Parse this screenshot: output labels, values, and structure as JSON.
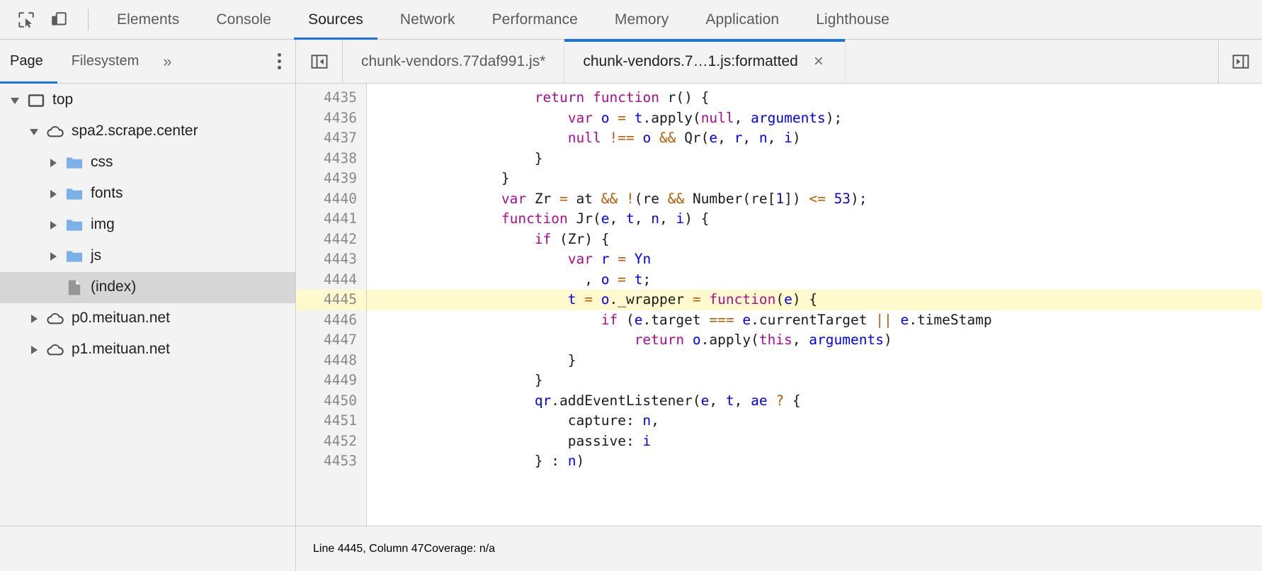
{
  "toolbar": {
    "inspect_icon": "inspect-element-icon",
    "device_icon": "device-toolbar-icon",
    "tabs": [
      {
        "label": "Elements",
        "active": false
      },
      {
        "label": "Console",
        "active": false
      },
      {
        "label": "Sources",
        "active": true
      },
      {
        "label": "Network",
        "active": false
      },
      {
        "label": "Performance",
        "active": false
      },
      {
        "label": "Memory",
        "active": false
      },
      {
        "label": "Application",
        "active": false
      },
      {
        "label": "Lighthouse",
        "active": false
      }
    ]
  },
  "navigator": {
    "tabs": [
      {
        "label": "Page",
        "active": true
      },
      {
        "label": "Filesystem",
        "active": false
      }
    ],
    "more_label": "»",
    "kebab_icon": "more-options-icon",
    "tree": [
      {
        "label": "top",
        "indent": 0,
        "twisty": "open",
        "icon": "frame-icon",
        "selected": false
      },
      {
        "label": "spa2.scrape.center",
        "indent": 1,
        "twisty": "open",
        "icon": "cloud-icon",
        "selected": false
      },
      {
        "label": "css",
        "indent": 2,
        "twisty": "closed",
        "icon": "folder-icon",
        "selected": false
      },
      {
        "label": "fonts",
        "indent": 2,
        "twisty": "closed",
        "icon": "folder-icon",
        "selected": false
      },
      {
        "label": "img",
        "indent": 2,
        "twisty": "closed",
        "icon": "folder-icon",
        "selected": false
      },
      {
        "label": "js",
        "indent": 2,
        "twisty": "closed",
        "icon": "folder-icon",
        "selected": false
      },
      {
        "label": "(index)",
        "indent": 2,
        "twisty": "none",
        "icon": "document-icon",
        "selected": true
      },
      {
        "label": "p0.meituan.net",
        "indent": 1,
        "twisty": "closed",
        "icon": "cloud-icon",
        "selected": false
      },
      {
        "label": "p1.meituan.net",
        "indent": 1,
        "twisty": "closed",
        "icon": "cloud-icon",
        "selected": false
      }
    ]
  },
  "editor": {
    "sidebar_toggle_icon": "show-navigator-icon",
    "expand_icon": "more-tabs-icon",
    "tabs": [
      {
        "label": "chunk-vendors.77daf991.js*",
        "active": false,
        "closable": false
      },
      {
        "label": "chunk-vendors.7…1.js:formatted",
        "active": true,
        "closable": true
      }
    ],
    "close_label": "×",
    "first_line_number": 4435,
    "highlighted_line": 4445,
    "lines": [
      {
        "n": 4435,
        "tokens": [
          {
            "t": "                    ",
            "c": "pl"
          },
          {
            "t": "return",
            "c": "kw"
          },
          {
            "t": " ",
            "c": "pl"
          },
          {
            "t": "function",
            "c": "kw"
          },
          {
            "t": " r() {",
            "c": "pl"
          }
        ]
      },
      {
        "n": 4436,
        "tokens": [
          {
            "t": "                        ",
            "c": "pl"
          },
          {
            "t": "var",
            "c": "kw"
          },
          {
            "t": " ",
            "c": "pl"
          },
          {
            "t": "o",
            "c": "var"
          },
          {
            "t": " ",
            "c": "pl"
          },
          {
            "t": "=",
            "c": "op"
          },
          {
            "t": " ",
            "c": "pl"
          },
          {
            "t": "t",
            "c": "var"
          },
          {
            "t": ".apply(",
            "c": "pl"
          },
          {
            "t": "null",
            "c": "kw"
          },
          {
            "t": ", ",
            "c": "pl"
          },
          {
            "t": "arguments",
            "c": "var"
          },
          {
            "t": ");",
            "c": "pl"
          }
        ]
      },
      {
        "n": 4437,
        "tokens": [
          {
            "t": "                        ",
            "c": "pl"
          },
          {
            "t": "null",
            "c": "kw"
          },
          {
            "t": " ",
            "c": "pl"
          },
          {
            "t": "!==",
            "c": "op"
          },
          {
            "t": " ",
            "c": "pl"
          },
          {
            "t": "o",
            "c": "var"
          },
          {
            "t": " ",
            "c": "pl"
          },
          {
            "t": "&&",
            "c": "op"
          },
          {
            "t": " Qr(",
            "c": "pl"
          },
          {
            "t": "e",
            "c": "var"
          },
          {
            "t": ", ",
            "c": "pl"
          },
          {
            "t": "r",
            "c": "var"
          },
          {
            "t": ", ",
            "c": "pl"
          },
          {
            "t": "n",
            "c": "var"
          },
          {
            "t": ", ",
            "c": "pl"
          },
          {
            "t": "i",
            "c": "var"
          },
          {
            "t": ")",
            "c": "pl"
          }
        ]
      },
      {
        "n": 4438,
        "tokens": [
          {
            "t": "                    }",
            "c": "pl"
          }
        ]
      },
      {
        "n": 4439,
        "tokens": [
          {
            "t": "                }",
            "c": "pl"
          }
        ]
      },
      {
        "n": 4440,
        "tokens": [
          {
            "t": "                ",
            "c": "pl"
          },
          {
            "t": "var",
            "c": "kw"
          },
          {
            "t": " Zr ",
            "c": "pl"
          },
          {
            "t": "=",
            "c": "op"
          },
          {
            "t": " at ",
            "c": "pl"
          },
          {
            "t": "&&",
            "c": "op"
          },
          {
            "t": " ",
            "c": "pl"
          },
          {
            "t": "!",
            "c": "op"
          },
          {
            "t": "(re ",
            "c": "pl"
          },
          {
            "t": "&&",
            "c": "op"
          },
          {
            "t": " Number(re[",
            "c": "pl"
          },
          {
            "t": "1",
            "c": "num"
          },
          {
            "t": "]) ",
            "c": "pl"
          },
          {
            "t": "<=",
            "c": "op"
          },
          {
            "t": " ",
            "c": "pl"
          },
          {
            "t": "53",
            "c": "num"
          },
          {
            "t": ");",
            "c": "pl"
          }
        ]
      },
      {
        "n": 4441,
        "tokens": [
          {
            "t": "                ",
            "c": "pl"
          },
          {
            "t": "function",
            "c": "kw"
          },
          {
            "t": " Jr(",
            "c": "pl"
          },
          {
            "t": "e",
            "c": "var"
          },
          {
            "t": ", ",
            "c": "pl"
          },
          {
            "t": "t",
            "c": "var"
          },
          {
            "t": ", ",
            "c": "pl"
          },
          {
            "t": "n",
            "c": "var"
          },
          {
            "t": ", ",
            "c": "pl"
          },
          {
            "t": "i",
            "c": "var"
          },
          {
            "t": ") {",
            "c": "pl"
          }
        ]
      },
      {
        "n": 4442,
        "tokens": [
          {
            "t": "                    ",
            "c": "pl"
          },
          {
            "t": "if",
            "c": "kw"
          },
          {
            "t": " (Zr) {",
            "c": "pl"
          }
        ]
      },
      {
        "n": 4443,
        "tokens": [
          {
            "t": "                        ",
            "c": "pl"
          },
          {
            "t": "var",
            "c": "kw"
          },
          {
            "t": " ",
            "c": "pl"
          },
          {
            "t": "r",
            "c": "var"
          },
          {
            "t": " ",
            "c": "pl"
          },
          {
            "t": "=",
            "c": "op"
          },
          {
            "t": " ",
            "c": "pl"
          },
          {
            "t": "Yn",
            "c": "var"
          }
        ]
      },
      {
        "n": 4444,
        "tokens": [
          {
            "t": "                          , ",
            "c": "pl"
          },
          {
            "t": "o",
            "c": "var"
          },
          {
            "t": " ",
            "c": "pl"
          },
          {
            "t": "=",
            "c": "op"
          },
          {
            "t": " ",
            "c": "pl"
          },
          {
            "t": "t",
            "c": "var"
          },
          {
            "t": ";",
            "c": "pl"
          }
        ]
      },
      {
        "n": 4445,
        "tokens": [
          {
            "t": "                        ",
            "c": "pl"
          },
          {
            "t": "t",
            "c": "var"
          },
          {
            "t": " ",
            "c": "pl"
          },
          {
            "t": "=",
            "c": "op"
          },
          {
            "t": " ",
            "c": "pl"
          },
          {
            "t": "o",
            "c": "var"
          },
          {
            "t": "._wrapper ",
            "c": "pl"
          },
          {
            "t": "=",
            "c": "op"
          },
          {
            "t": " ",
            "c": "pl"
          },
          {
            "t": "function",
            "c": "kw"
          },
          {
            "t": "(",
            "c": "pl"
          },
          {
            "t": "e",
            "c": "var"
          },
          {
            "t": ") {",
            "c": "pl"
          }
        ]
      },
      {
        "n": 4446,
        "tokens": [
          {
            "t": "                            ",
            "c": "pl"
          },
          {
            "t": "if",
            "c": "kw"
          },
          {
            "t": " (",
            "c": "pl"
          },
          {
            "t": "e",
            "c": "var"
          },
          {
            "t": ".target ",
            "c": "pl"
          },
          {
            "t": "===",
            "c": "op"
          },
          {
            "t": " ",
            "c": "pl"
          },
          {
            "t": "e",
            "c": "var"
          },
          {
            "t": ".currentTarget ",
            "c": "pl"
          },
          {
            "t": "||",
            "c": "op"
          },
          {
            "t": " ",
            "c": "pl"
          },
          {
            "t": "e",
            "c": "var"
          },
          {
            "t": ".timeStamp",
            "c": "pl"
          }
        ]
      },
      {
        "n": 4447,
        "tokens": [
          {
            "t": "                                ",
            "c": "pl"
          },
          {
            "t": "return",
            "c": "kw"
          },
          {
            "t": " ",
            "c": "pl"
          },
          {
            "t": "o",
            "c": "var"
          },
          {
            "t": ".apply(",
            "c": "pl"
          },
          {
            "t": "this",
            "c": "kw"
          },
          {
            "t": ", ",
            "c": "pl"
          },
          {
            "t": "arguments",
            "c": "var"
          },
          {
            "t": ")",
            "c": "pl"
          }
        ]
      },
      {
        "n": 4448,
        "tokens": [
          {
            "t": "                        }",
            "c": "pl"
          }
        ]
      },
      {
        "n": 4449,
        "tokens": [
          {
            "t": "                    }",
            "c": "pl"
          }
        ]
      },
      {
        "n": 4450,
        "tokens": [
          {
            "t": "                    ",
            "c": "pl"
          },
          {
            "t": "qr",
            "c": "var"
          },
          {
            "t": ".addEventListener(",
            "c": "pl"
          },
          {
            "t": "e",
            "c": "var"
          },
          {
            "t": ", ",
            "c": "pl"
          },
          {
            "t": "t",
            "c": "var"
          },
          {
            "t": ", ",
            "c": "pl"
          },
          {
            "t": "ae",
            "c": "var"
          },
          {
            "t": " ",
            "c": "pl"
          },
          {
            "t": "?",
            "c": "op"
          },
          {
            "t": " {",
            "c": "pl"
          }
        ]
      },
      {
        "n": 4451,
        "tokens": [
          {
            "t": "                        capture: ",
            "c": "pl"
          },
          {
            "t": "n",
            "c": "var"
          },
          {
            "t": ",",
            "c": "pl"
          }
        ]
      },
      {
        "n": 4452,
        "tokens": [
          {
            "t": "                        passive: ",
            "c": "pl"
          },
          {
            "t": "i",
            "c": "var"
          }
        ]
      },
      {
        "n": 4453,
        "tokens": [
          {
            "t": "                    } : ",
            "c": "pl"
          },
          {
            "t": "n",
            "c": "var"
          },
          {
            "t": ")",
            "c": "pl"
          }
        ]
      }
    ]
  },
  "statusbar": {
    "position": "Line 4445, Column 47",
    "coverage": "Coverage: n/a"
  },
  "colors": {
    "accent": "#1a73e8",
    "chrome_bg": "#f3f3f3",
    "editor_bg": "#ffffff",
    "highlight_line": "#fffacd",
    "selection": "#d6d6d6",
    "folder": "#7cb0e8",
    "keyword": "#aa0d91",
    "variable": "#0000ee",
    "operator": "#b85c00",
    "number": "#1c00cf",
    "line_number": "#888888"
  }
}
